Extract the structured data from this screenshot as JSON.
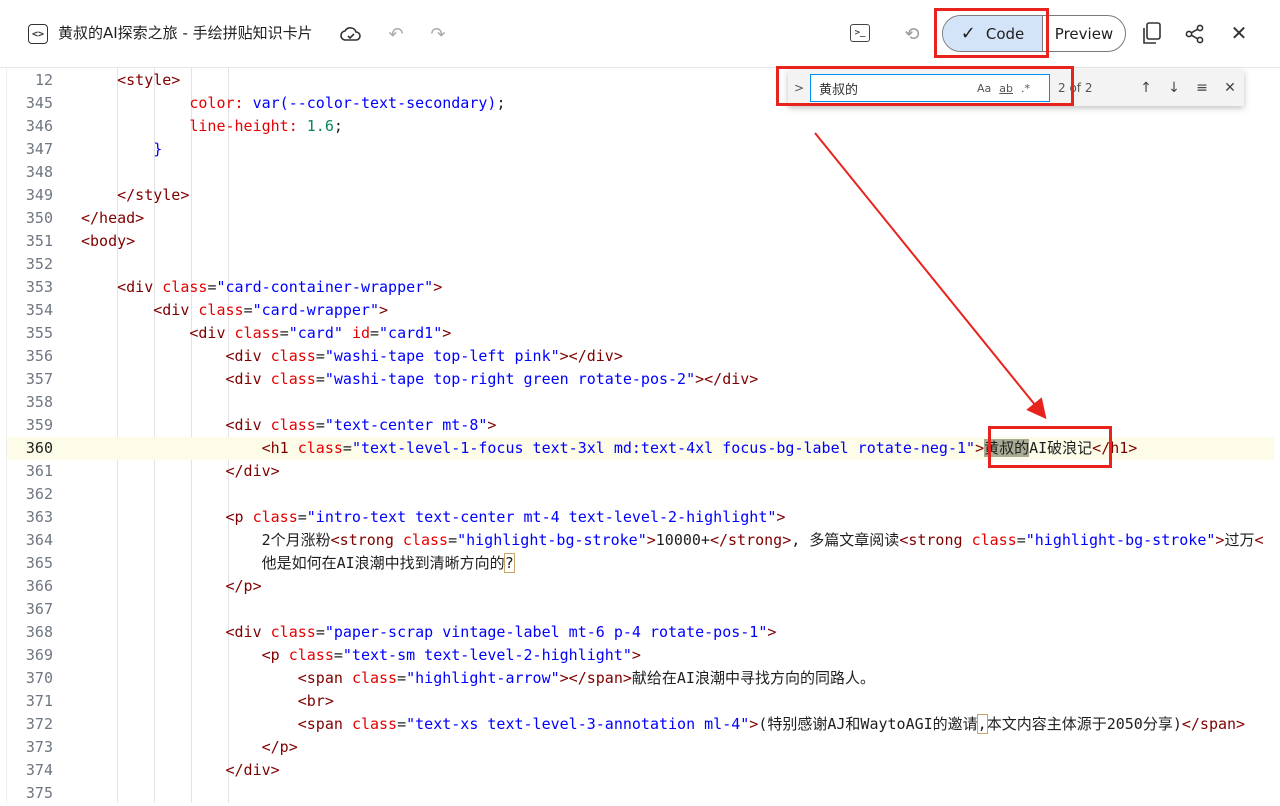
{
  "header": {
    "doc_icon_glyph": "<>",
    "title": "黄叔的AI探索之旅 - 手绘拼贴知识卡片",
    "code_label": "Code",
    "preview_label": "Preview",
    "terminal_glyph": ">_"
  },
  "find": {
    "query": "黄叔的",
    "opt_case": "Aa",
    "opt_word": "ab",
    "opt_regex": ".*",
    "match_count": "2 of 2"
  },
  "editor": {
    "line_numbers": [
      "12",
      "345",
      "346",
      "347",
      "348",
      "349",
      "350",
      "351",
      "352",
      "353",
      "354",
      "355",
      "356",
      "357",
      "358",
      "359",
      "360",
      "361",
      "362",
      "363",
      "364",
      "365",
      "366",
      "367",
      "368",
      "369",
      "370",
      "371",
      "372",
      "373",
      "374",
      "375"
    ],
    "active_line": "360"
  },
  "colors": {
    "annotation_red": "#e8231e",
    "code_button_bg": "#d4e4f8",
    "tag": "#800000",
    "attr": "#e50000",
    "string": "#0000ff",
    "number": "#098658"
  }
}
